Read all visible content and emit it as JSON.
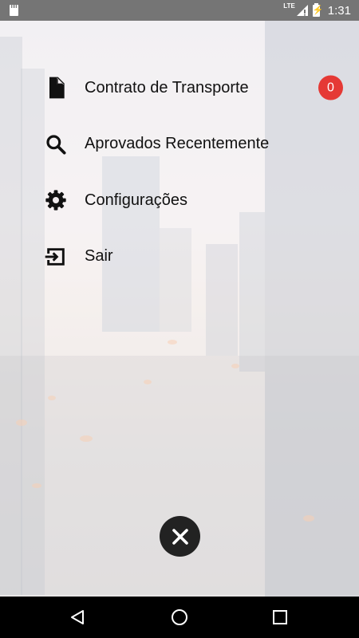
{
  "status_bar": {
    "network": "LTE",
    "time": "1:31",
    "icons": [
      "sd-card-icon",
      "signal-icon",
      "battery-charging-icon"
    ]
  },
  "menu": {
    "items": [
      {
        "label": "Contrato de Transporte",
        "icon": "document-icon",
        "badge": "0"
      },
      {
        "label": "Aprovados Recentemente",
        "icon": "search-icon"
      },
      {
        "label": "Configurações",
        "icon": "gear-icon"
      },
      {
        "label": "Sair",
        "icon": "exit-icon"
      }
    ]
  },
  "close_button": {
    "icon": "close-icon"
  },
  "nav_bar": {
    "icons": [
      "back-icon",
      "home-icon",
      "recents-icon"
    ]
  },
  "colors": {
    "badge": "#e53935",
    "status_bar": "#757575",
    "nav_bar": "#000000",
    "close_button": "#222222"
  }
}
